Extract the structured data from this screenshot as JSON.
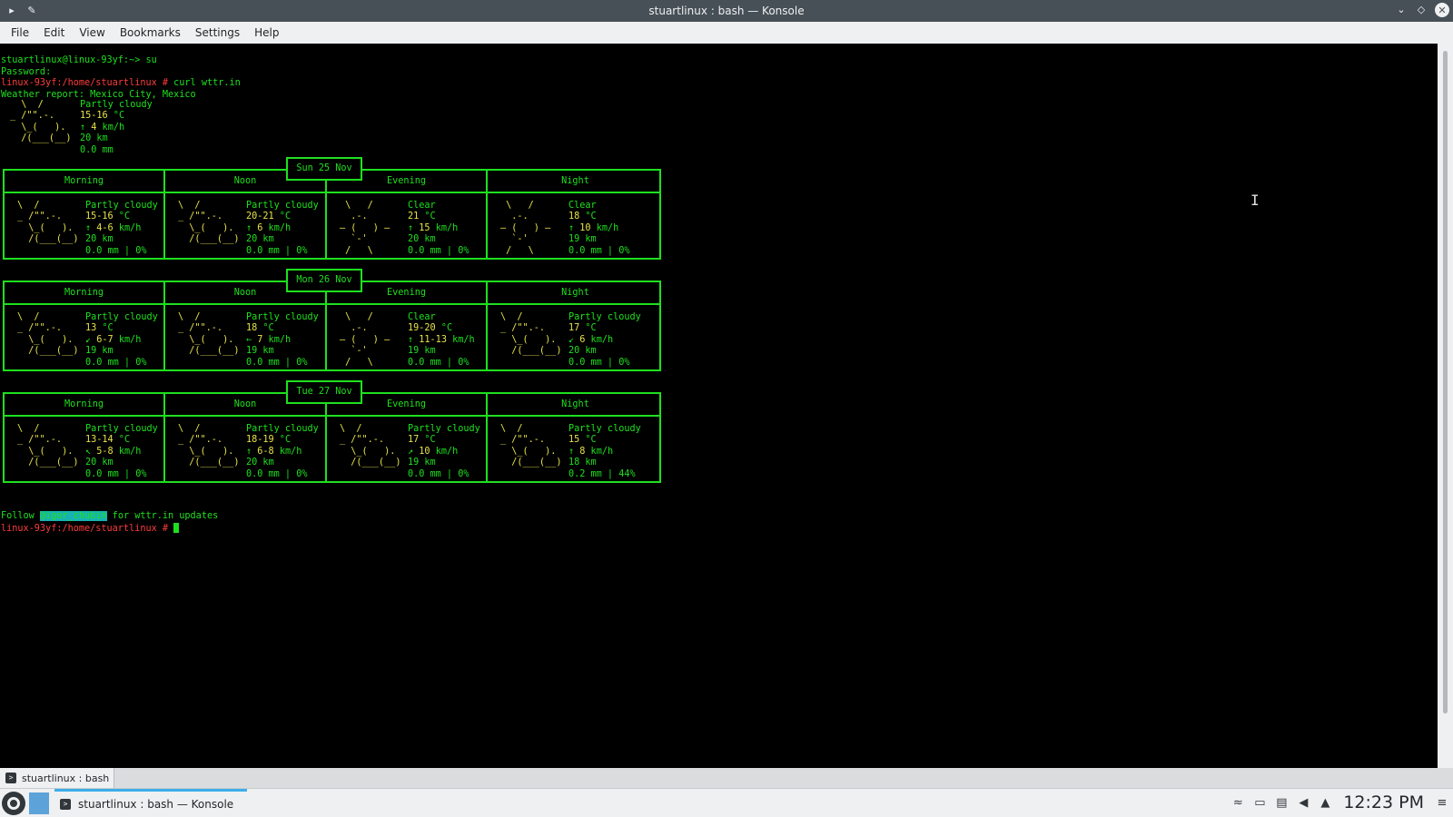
{
  "window": {
    "title": "stuartlinux : bash — Konsole",
    "menu": [
      "File",
      "Edit",
      "View",
      "Bookmarks",
      "Settings",
      "Help"
    ]
  },
  "terminal": {
    "line1": "stuartlinux@linux-93yf:~> su",
    "line2": "Password:",
    "prompt": "linux-93yf:/home/stuartlinux #",
    "command": " curl wttr.in",
    "report": "Weather report: Mexico City, Mexico",
    "current": {
      "art": "  \\  /\n_ /\"\".-.\n  \\_(   ).\n  /(___(__)",
      "condition": "Partly cloudy",
      "temp": "15-16",
      "temp_unit": " °C",
      "wind_arrow": "↑ ",
      "wind": "4",
      "wind_unit": " km/h",
      "visibility": "20 km",
      "precip": "0.0 mm"
    },
    "follow_pre": "Follow ",
    "follow_link": "@igor_chubin",
    "follow_post": " for wttr.in updates",
    "final_prompt": "linux-93yf:/home/stuartlinux #"
  },
  "columns": [
    "Morning",
    "Noon",
    "Evening",
    "Night"
  ],
  "days": [
    {
      "date": "Sun 25 Nov",
      "periods": [
        {
          "art": "cloudy",
          "cond": "Partly cloudy",
          "temp": "15-16",
          "arrow": "↑",
          "wind": "4-6",
          "vis": "20 km",
          "precip": "0.0 mm | 0%"
        },
        {
          "art": "cloudy",
          "cond": "Partly cloudy",
          "temp": "20-21",
          "arrow": "↑",
          "wind": "6",
          "vis": "20 km",
          "precip": "0.0 mm | 0%"
        },
        {
          "art": "sun",
          "cond": "Clear",
          "temp": "21",
          "arrow": "↑",
          "wind": "15",
          "vis": "20 km",
          "precip": "0.0 mm | 0%"
        },
        {
          "art": "sun",
          "cond": "Clear",
          "temp": "18",
          "arrow": "↑",
          "wind": "10",
          "vis": "19 km",
          "precip": "0.0 mm | 0%"
        }
      ]
    },
    {
      "date": "Mon 26 Nov",
      "periods": [
        {
          "art": "cloudy",
          "cond": "Partly cloudy",
          "temp": "13",
          "arrow": "↙",
          "wind": "6-7",
          "vis": "19 km",
          "precip": "0.0 mm | 0%"
        },
        {
          "art": "cloudy",
          "cond": "Partly cloudy",
          "temp": "18",
          "arrow": "←",
          "wind": "7",
          "vis": "19 km",
          "precip": "0.0 mm | 0%"
        },
        {
          "art": "sun",
          "cond": "Clear",
          "temp": "19-20",
          "arrow": "↑",
          "wind": "11-13",
          "vis": "19 km",
          "precip": "0.0 mm | 0%"
        },
        {
          "art": "cloudy",
          "cond": "Partly cloudy",
          "temp": "17",
          "arrow": "↙",
          "wind": "6",
          "vis": "20 km",
          "precip": "0.0 mm | 0%"
        }
      ]
    },
    {
      "date": "Tue 27 Nov",
      "periods": [
        {
          "art": "cloudy",
          "cond": "Partly cloudy",
          "temp": "13-14",
          "arrow": "↖",
          "wind": "5-8",
          "vis": "20 km",
          "precip": "0.0 mm | 0%"
        },
        {
          "art": "cloudy",
          "cond": "Partly cloudy",
          "temp": "18-19",
          "arrow": "↑",
          "wind": "6-8",
          "vis": "20 km",
          "precip": "0.0 mm | 0%"
        },
        {
          "art": "cloudy",
          "cond": "Partly cloudy",
          "temp": "17",
          "arrow": "↗",
          "wind": "10",
          "vis": "19 km",
          "precip": "0.0 mm | 0%"
        },
        {
          "art": "cloudy",
          "cond": "Partly cloudy",
          "temp": "15",
          "arrow": "↑",
          "wind": "8",
          "vis": "18 km",
          "precip": "0.2 mm | 44%"
        }
      ]
    }
  ],
  "art_cloudy": "\\  /\n_ /\"\".-.\n  \\_(   ).\n  /(___(__)",
  "art_sun": " \\   /\n  .-.\n― (   ) ―\n  `-'\n /   \\",
  "temp_unit": " °C",
  "wind_unit": " km/h",
  "tab_label": "stuartlinux : bash",
  "panel": {
    "task_label": "stuartlinux : bash — Konsole",
    "clock": "12:23 PM"
  },
  "colors": {
    "terminal_green": "#1ee01e",
    "prompt_red": "#ff3b3b",
    "art_yellow": "#e8e34a",
    "accent": "#3daee9"
  }
}
